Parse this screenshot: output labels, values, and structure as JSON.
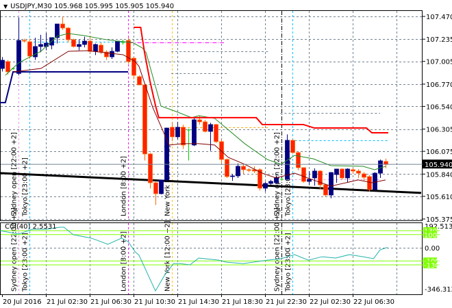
{
  "header": {
    "symbol": "USDJPY,M30",
    "open": "105.968",
    "high": "105.995",
    "low": "105.905",
    "close": "105.940",
    "menu_icon": "triangle-down-icon"
  },
  "chart_data": {
    "type": "candlestick",
    "symbol": "USDJPY",
    "timeframe": "M30",
    "price_axis_ticks": [
      "107.470",
      "107.235",
      "107.005",
      "106.770",
      "106.540",
      "106.305",
      "106.075",
      "105.840",
      "105.610",
      "105.375"
    ],
    "ylim": [
      105.375,
      107.47
    ],
    "current_price": "105.940",
    "time_axis_labels": [
      "20 Jul 2016",
      "21 Jul 02:30",
      "21 Jul 06:30",
      "21 Jul 10:30",
      "21 Jul 14:30",
      "21 Jul 18:30",
      "21 Jul 22:30",
      "22 Jul 02:30",
      "22 Jul 06:30"
    ],
    "bars_per_label": 8,
    "colors": {
      "bull": "#000080",
      "bear": "#ff2200",
      "bear_border": "#ff6600",
      "doji": "#00cc00",
      "ma_fast": "#228b22",
      "ma_slow": "#800000",
      "stop_line": "#ff0000",
      "trend_line": "#000000",
      "range_line": "#000080",
      "cci": "#20b2aa",
      "cci_levels": "#7fff00",
      "grid": "#708090"
    },
    "ohlc": [
      [
        106.932,
        107.05,
        106.9,
        107.017
      ],
      [
        107.003,
        107.02,
        106.87,
        106.897
      ],
      [
        106.93,
        106.94,
        106.92,
        106.93
      ],
      [
        106.88,
        107.46,
        106.86,
        107.222
      ],
      [
        107.222,
        107.24,
        107.2,
        107.215
      ],
      [
        107.208,
        107.24,
        107.03,
        107.06
      ],
      [
        107.052,
        107.25,
        107.02,
        107.159
      ],
      [
        107.159,
        107.28,
        107.1,
        107.18
      ],
      [
        107.159,
        107.3,
        107.12,
        107.194
      ],
      [
        107.173,
        107.25,
        107.13,
        107.251
      ],
      [
        107.251,
        107.36,
        107.19,
        107.392
      ],
      [
        107.392,
        107.47,
        107.33,
        107.35
      ],
      [
        107.35,
        107.36,
        107.2,
        107.229
      ],
      [
        107.229,
        107.24,
        107.15,
        107.159
      ],
      [
        107.159,
        107.23,
        107.12,
        107.18
      ],
      [
        107.18,
        107.26,
        107.15,
        107.215
      ],
      [
        107.215,
        107.27,
        107.09,
        107.109
      ],
      [
        107.109,
        107.19,
        107.07,
        107.18
      ],
      [
        107.173,
        107.2,
        107.08,
        107.102
      ],
      [
        107.102,
        107.12,
        107.02,
        107.052
      ],
      [
        107.052,
        107.15,
        107.03,
        107.109
      ],
      [
        107.109,
        107.21,
        107.1,
        107.215
      ],
      [
        107.201,
        107.23,
        107.18,
        107.201
      ],
      [
        107.222,
        107.25,
        106.98,
        107.003
      ],
      [
        107.038,
        107.05,
        106.82,
        106.861
      ],
      [
        106.847,
        106.86,
        106.76,
        106.762
      ],
      [
        106.762,
        106.77,
        105.98,
        106.048
      ],
      [
        106.048,
        106.06,
        105.69,
        105.75
      ],
      [
        105.75,
        105.76,
        105.52,
        105.637
      ],
      [
        105.637,
        105.76,
        105.63,
        105.779
      ],
      [
        105.779,
        106.32,
        105.77,
        106.316
      ],
      [
        106.324,
        106.38,
        106.18,
        106.225
      ],
      [
        106.225,
        106.38,
        106.2,
        106.324
      ],
      [
        106.324,
        106.35,
        106.1,
        106.14
      ],
      [
        106.295,
        106.31,
        105.98,
        106.295
      ],
      [
        106.14,
        106.42,
        106.13,
        106.401
      ],
      [
        106.401,
        106.44,
        106.35,
        106.38
      ],
      [
        106.38,
        106.4,
        106.27,
        106.281
      ],
      [
        106.281,
        106.37,
        106.08,
        106.352
      ],
      [
        106.352,
        106.36,
        106.16,
        106.175
      ],
      [
        106.175,
        106.2,
        105.95,
        105.991
      ],
      [
        105.991,
        106.0,
        105.8,
        105.814
      ],
      [
        105.814,
        105.84,
        105.77,
        105.821
      ],
      [
        105.821,
        105.95,
        105.8,
        105.92
      ],
      [
        105.92,
        105.94,
        105.84,
        105.885
      ],
      [
        105.885,
        105.9,
        105.86,
        105.878
      ],
      [
        105.885,
        105.92,
        105.85,
        105.871
      ],
      [
        105.885,
        105.9,
        105.67,
        105.694
      ],
      [
        105.694,
        105.76,
        105.66,
        105.743
      ],
      [
        105.743,
        105.78,
        105.73,
        105.764
      ],
      [
        105.75,
        105.82,
        105.74,
        105.8
      ],
      [
        105.786,
        105.8,
        105.77,
        105.786
      ],
      [
        105.786,
        106.25,
        105.78,
        106.189
      ],
      [
        106.189,
        106.2,
        106.05,
        106.062
      ],
      [
        106.062,
        106.07,
        105.88,
        105.906
      ],
      [
        105.906,
        105.91,
        105.75,
        105.764
      ],
      [
        105.764,
        105.87,
        105.73,
        105.786
      ],
      [
        105.8,
        105.9,
        105.72,
        105.871
      ],
      [
        105.871,
        105.88,
        105.68,
        105.729
      ],
      [
        105.729,
        105.74,
        105.61,
        105.623
      ],
      [
        105.623,
        105.86,
        105.59,
        105.856
      ],
      [
        105.835,
        105.87,
        105.75,
        105.892
      ],
      [
        105.892,
        105.9,
        105.78,
        105.8
      ],
      [
        105.8,
        105.9,
        105.75,
        105.892
      ],
      [
        105.885,
        105.9,
        105.84,
        105.871
      ],
      [
        105.871,
        105.89,
        105.8,
        105.849
      ],
      [
        105.842,
        105.86,
        105.77,
        105.807
      ],
      [
        105.814,
        105.83,
        105.66,
        105.679
      ],
      [
        105.679,
        105.86,
        105.67,
        105.849
      ],
      [
        105.849,
        105.99,
        105.8,
        105.977
      ],
      [
        105.97,
        106.0,
        105.9,
        105.94
      ]
    ],
    "ma_fast": [
      [
        0.6,
        106.861
      ],
      [
        3,
        106.989
      ],
      [
        7.1,
        107.109
      ],
      [
        10,
        107.265
      ],
      [
        12.1,
        107.293
      ],
      [
        15,
        107.272
      ],
      [
        18.4,
        107.236
      ],
      [
        20.9,
        107.215
      ],
      [
        23.8,
        107.201
      ],
      [
        25.6,
        107.144
      ],
      [
        26.3,
        107.095
      ],
      [
        29,
        106.543
      ],
      [
        31.8,
        106.486
      ],
      [
        34.6,
        106.423
      ],
      [
        35.9,
        106.444
      ],
      [
        38.8,
        106.416
      ],
      [
        40.9,
        106.316
      ],
      [
        44.3,
        106.154
      ],
      [
        48.4,
        105.991
      ],
      [
        50.9,
        105.941
      ],
      [
        53.4,
        106.033
      ],
      [
        56.8,
        105.998
      ],
      [
        60,
        105.927
      ],
      [
        65.9,
        105.92
      ],
      [
        68,
        105.885
      ],
      [
        70,
        105.92
      ]
    ],
    "ma_slow": [
      [
        2.1,
        106.897
      ],
      [
        7.1,
        106.932
      ],
      [
        12.1,
        107.109
      ],
      [
        15.5,
        107.116
      ],
      [
        18.8,
        107.095
      ],
      [
        22.1,
        107.074
      ],
      [
        24.3,
        107.003
      ],
      [
        25,
        106.953
      ],
      [
        27.5,
        106.529
      ],
      [
        30.5,
        106.14
      ],
      [
        33,
        106.154
      ],
      [
        35.9,
        106.154
      ],
      [
        38.8,
        106.14
      ],
      [
        41.3,
        106.012
      ],
      [
        44.3,
        105.941
      ],
      [
        47.5,
        105.849
      ],
      [
        50,
        105.8
      ],
      [
        53.4,
        105.849
      ],
      [
        56.8,
        105.779
      ],
      [
        60,
        105.715
      ],
      [
        65,
        105.779
      ],
      [
        67.5,
        105.75
      ],
      [
        70,
        105.779
      ]
    ],
    "stop_line": [
      [
        24,
        107.357
      ],
      [
        25.3,
        107.357
      ],
      [
        26,
        107.1
      ],
      [
        27,
        106.8
      ],
      [
        28,
        106.55
      ],
      [
        28.6,
        106.423
      ],
      [
        46.4,
        106.423
      ],
      [
        47.5,
        106.352
      ],
      [
        55,
        106.352
      ],
      [
        57,
        106.316
      ],
      [
        66.5,
        106.316
      ],
      [
        67.5,
        106.267
      ],
      [
        70.5,
        106.267
      ]
    ],
    "range_line": [
      [
        -0.4,
        106.579
      ],
      [
        0.6,
        106.579
      ],
      [
        2,
        106.897
      ],
      [
        23,
        106.897
      ]
    ],
    "trend_line": [
      [
        -0.4,
        105.85
      ],
      [
        76.5,
        105.645
      ]
    ],
    "levels": [
      {
        "from": 5,
        "to": 23,
        "price": 107.208,
        "color": "#00bfff",
        "style": "dash"
      },
      {
        "from": 23.3,
        "to": 40.5,
        "price": 107.201,
        "color": "#ff00ff",
        "style": "dashdot"
      },
      {
        "from": 30.9,
        "to": 48.6,
        "price": 106.324,
        "color": "#ffa500",
        "style": "dash"
      },
      {
        "from": 52.7,
        "to": 70.5,
        "price": 106.189,
        "color": "#00bfff",
        "style": "dash"
      },
      {
        "from": 52.7,
        "to": 69,
        "price": 105.786,
        "color": "#dda0dd",
        "style": "dash"
      },
      {
        "from": 30.9,
        "to": 48.6,
        "price": 107.11,
        "color": "#708090",
        "style": "dash"
      },
      {
        "from": 30.9,
        "to": 41,
        "price": 106.88,
        "color": "#708090",
        "style": "dash"
      },
      {
        "from": 50.8,
        "to": 69,
        "price": 106.47,
        "color": "#708090",
        "style": "dash"
      }
    ],
    "sessions": [
      {
        "label": "Sydney open  [22:00 +2]",
        "bar": 3,
        "color": "#dda0dd",
        "style": "dash"
      },
      {
        "label": "Tokyo  [23:00 +2]",
        "bar": 5,
        "color": "#00bfff",
        "style": "dash"
      },
      {
        "label": "London  [8:00 +2]",
        "bar": 23,
        "color": "#ff00ff",
        "style": "dash"
      },
      {
        "label": "New York  [12:00 +2]",
        "bar": 31,
        "color": "#ffc000",
        "style": "dash"
      },
      {
        "label": "Sydney open  [22:00 +2]",
        "bar": 51,
        "color": "#000000",
        "style": "dashdot"
      },
      {
        "label": "Tokyo  [23:00 +2]",
        "bar": 53,
        "color": "#00bfff",
        "style": "dash"
      }
    ],
    "indicator": {
      "name": "CCI(40)",
      "value": "2.5531",
      "axis_max": "192.5137",
      "axis_zero": "0.00",
      "axis_min": "-346.3128",
      "levels": [
        "130",
        "100",
        "-100",
        "-130"
      ],
      "level_values": [
        130,
        100,
        -100,
        -130
      ],
      "ylim": [
        -346.3128,
        192.5137
      ],
      "series": [
        [
          -0.4,
          130
        ],
        [
          3,
          104
        ],
        [
          5.5,
          140
        ],
        [
          8,
          140
        ],
        [
          10.5,
          156
        ],
        [
          11.3,
          156
        ],
        [
          13,
          99
        ],
        [
          16.3,
          73
        ],
        [
          18,
          47
        ],
        [
          19.3,
          26
        ],
        [
          21.8,
          73
        ],
        [
          23,
          47
        ],
        [
          24.3,
          -31
        ],
        [
          25,
          -57
        ],
        [
          28,
          -328
        ],
        [
          29.6,
          -213
        ],
        [
          31.3,
          -120
        ],
        [
          32.5,
          -120
        ],
        [
          34.3,
          -130
        ],
        [
          35.9,
          -78
        ],
        [
          37.1,
          -83
        ],
        [
          39.6,
          -94
        ],
        [
          40.9,
          -109
        ],
        [
          44,
          -120
        ],
        [
          48.4,
          -94
        ],
        [
          50.9,
          -83
        ],
        [
          53.4,
          -52
        ],
        [
          55.9,
          -94
        ],
        [
          58.4,
          -68
        ],
        [
          60.9,
          -78
        ],
        [
          63.4,
          -52
        ],
        [
          65.9,
          -68
        ],
        [
          67.8,
          -83
        ],
        [
          69,
          -16
        ],
        [
          70.3,
          2.5531
        ]
      ]
    }
  }
}
